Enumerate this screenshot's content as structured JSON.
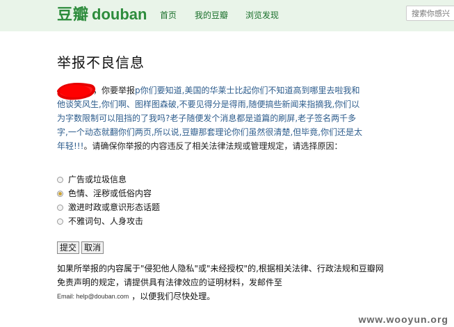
{
  "header": {
    "logo_cn": "豆瓣",
    "logo_en": "douban",
    "nav": [
      {
        "label": "首页"
      },
      {
        "label": "我的豆瓣"
      },
      {
        "label": "浏览发现"
      }
    ],
    "search_placeholder": "搜索你感兴"
  },
  "page": {
    "title": "举报不良信息",
    "desc_lead": "，你要举报",
    "desc_quote": "p你们要知道,美国的华莱士比起你们不知道高到哪里去啦我和他谈笑风生,你们啊、图样图森破,不要见得分是得雨,随便搞些新闻来指摘我,你们以为字数限制可以阻挡的了我吗?老子随便发个消息都是道篇的刷屏,老子签名两千多字,一个动态就翻你们两页,所以说,豆瓣那套理论你们虽然很清楚,但毕竟,你们还是太年轻!!!",
    "desc_tail": "。请确保你举报的内容违反了相关法律法规或管理规定，请选择原因：",
    "reasons": [
      {
        "label": "广告或垃圾信息",
        "selected": false
      },
      {
        "label": "色情、淫秽或低俗内容",
        "selected": true
      },
      {
        "label": "激进时政或意识形态话题",
        "selected": false
      },
      {
        "label": "不雅词句、人身攻击",
        "selected": false
      }
    ],
    "submit_label": "提交",
    "cancel_label": "取消",
    "note_line": "如果所举报的内容属于\"侵犯他人隐私\"或\"未经授权\"的,根据相关法律、行政法规和豆瓣网免责声明的规定，请提供具有法律效应的证明材料，发邮件至",
    "email": "Email: help@douban.com",
    "note_tail": "，以便我们尽快处理。"
  },
  "watermark": "www.wooyun.org",
  "colors": {
    "topbar": "#e9f4e9",
    "brand": "#2d8c3c",
    "redaction": "#ff0000"
  }
}
